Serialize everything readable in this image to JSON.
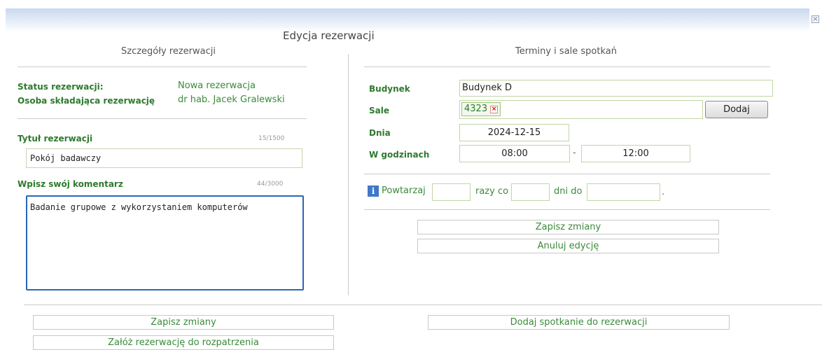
{
  "dialog": {
    "title": "Edycja rezerwacji",
    "close_icon": "close-icon"
  },
  "left": {
    "section_title": "Szczegóły rezerwacji",
    "status_label": "Status rezerwacji:",
    "status_value": "Nowa rezerwacja",
    "person_label": "Osoba składająca rezerwację",
    "person_value": "dr hab. Jacek Gralewski",
    "title_label": "Tytuł rezerwacji",
    "title_counter": "15/1500",
    "title_value": "Pokój badawczy",
    "comment_label": "Wpisz swój komentarz",
    "comment_counter": "44/3000",
    "comment_value": "Badanie grupowe z wykorzystaniem komputerów "
  },
  "right": {
    "section_title": "Terminy i sale spotkań",
    "building_label": "Budynek",
    "building_value": "Budynek D",
    "rooms_label": "Sale",
    "room_tag": "4323",
    "add_button": "Dodaj",
    "day_label": "Dnia",
    "day_value": "2024-12-15",
    "hours_label": "W godzinach",
    "time_from": "08:00",
    "time_separator": "-",
    "time_to": "12:00",
    "repeat_label": "Powtarzaj",
    "repeat_times_label": "razy co",
    "repeat_days_label": "dni do",
    "repeat_end": ".",
    "save_button": "Zapisz zmiany",
    "cancel_button": "Anuluj edycję"
  },
  "bottom": {
    "save_button": "Zapisz zmiany",
    "add_meeting_button": "Dodaj spotkanie do rezerwacji",
    "submit_button": "Załóż rezerwację do rozpatrzenia"
  },
  "colors": {
    "accent_green": "#2e7a2e",
    "border_green": "#c2d6a6",
    "focus_blue": "#2b66b8"
  }
}
